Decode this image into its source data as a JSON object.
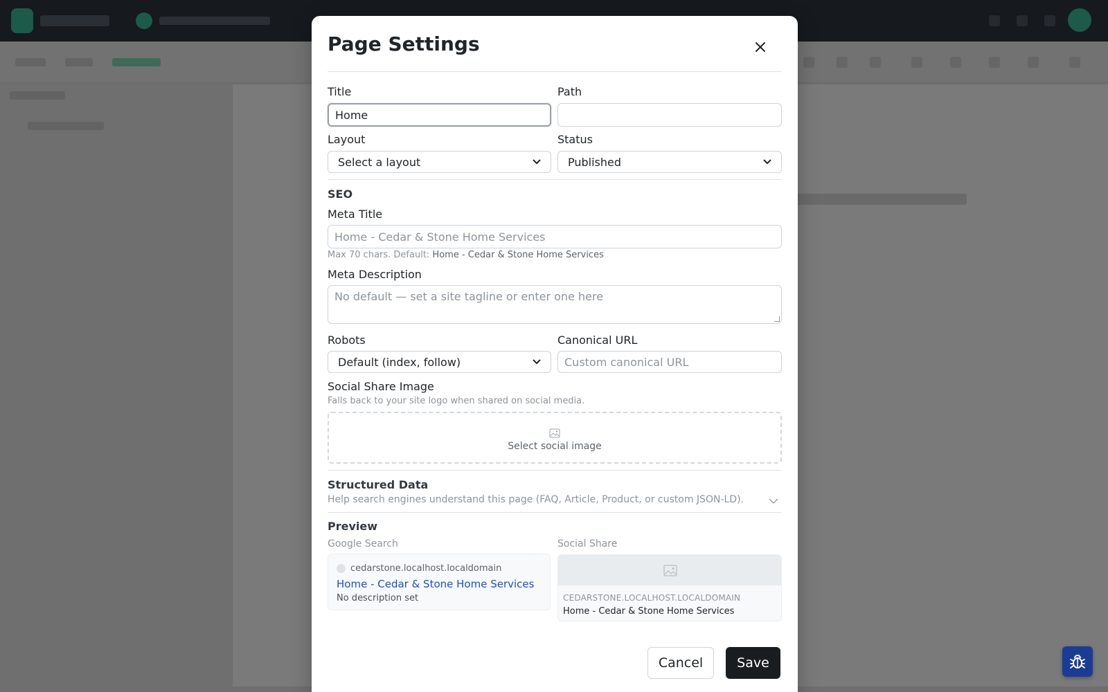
{
  "modal": {
    "title": "Page Settings",
    "close_label": "×"
  },
  "fields": {
    "title_label": "Title",
    "title_value": "Home",
    "path_label": "Path",
    "path_value": "",
    "layout_label": "Layout",
    "layout_selected": "Select a layout",
    "status_label": "Status",
    "status_selected": "Published"
  },
  "seo": {
    "heading": "SEO",
    "meta_title_label": "Meta Title",
    "meta_title_placeholder": "Home - Cedar & Stone Home Services",
    "meta_title_hint_prefix": "Max 70 chars. Default:",
    "meta_title_hint_default": "Home - Cedar & Stone Home Services",
    "meta_description_label": "Meta Description",
    "meta_description_placeholder": "No default — set a site tagline or enter one here",
    "robots_label": "Robots",
    "robots_selected": "Default (index, follow)",
    "canonical_label": "Canonical URL",
    "canonical_placeholder": "Custom canonical URL",
    "social_image_label": "Social Share Image",
    "social_image_hint": "Falls back to your site logo when shared on social media.",
    "social_image_button": "Select social image"
  },
  "structured_data": {
    "title": "Structured Data",
    "subtitle": "Help search engines understand this page (FAQ, Article, Product, or custom JSON-LD)."
  },
  "preview": {
    "heading": "Preview",
    "google_label": "Google Search",
    "google_domain": "cedarstone.localhost.localdomain",
    "google_title": "Home - Cedar & Stone Home Services",
    "google_description": "No description set",
    "social_label": "Social Share",
    "social_domain": "cedarstone.localhost.localdomain",
    "social_title": "Home - Cedar & Stone Home Services"
  },
  "actions": {
    "cancel": "Cancel",
    "save": "Save"
  },
  "icons": {
    "close": "close-icon",
    "image": "image-icon",
    "chevron": "chevron-down-icon",
    "bug": "bug-icon"
  },
  "colors": {
    "save_bg": "#1a1d20",
    "link": "#1a4fd6",
    "bug_bg": "#1b3c95"
  }
}
